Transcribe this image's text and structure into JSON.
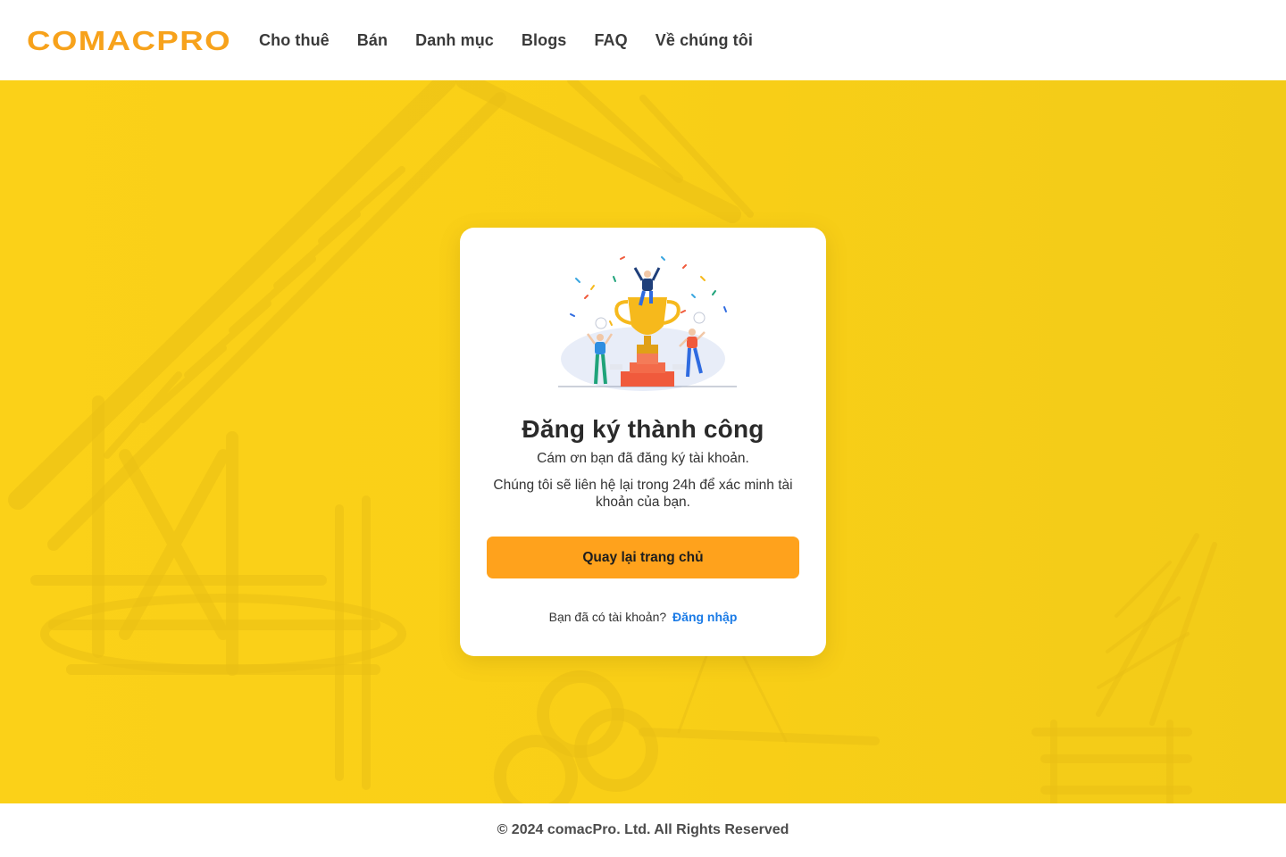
{
  "header": {
    "logo_text": "COMACPRO",
    "nav": [
      {
        "label": "Cho thuê"
      },
      {
        "label": "Bán"
      },
      {
        "label": "Danh mục"
      },
      {
        "label": "Blogs"
      },
      {
        "label": "FAQ"
      },
      {
        "label": "Về chúng tôi"
      }
    ]
  },
  "card": {
    "title": "Đăng ký thành công",
    "text_1": "Cám ơn bạn đã đăng ký tài khoản.",
    "text_2": "Chúng tôi sẽ liên hệ lại trong 24h để xác minh tài khoản của bạn.",
    "button_label": "Quay lại trang chủ",
    "login_prompt": "Bạn đã có tài khoản?",
    "login_link": "Đăng nhập"
  },
  "footer": {
    "copyright": "© 2024 comacPro. Ltd. All Rights Reserved"
  },
  "colors": {
    "brand": "#f7a21b",
    "hero_background": "#f9cf17",
    "primary_button": "#ffa21c",
    "link": "#1b7be6"
  },
  "icons": {
    "illustration": "trophy-celebration-illustration"
  }
}
